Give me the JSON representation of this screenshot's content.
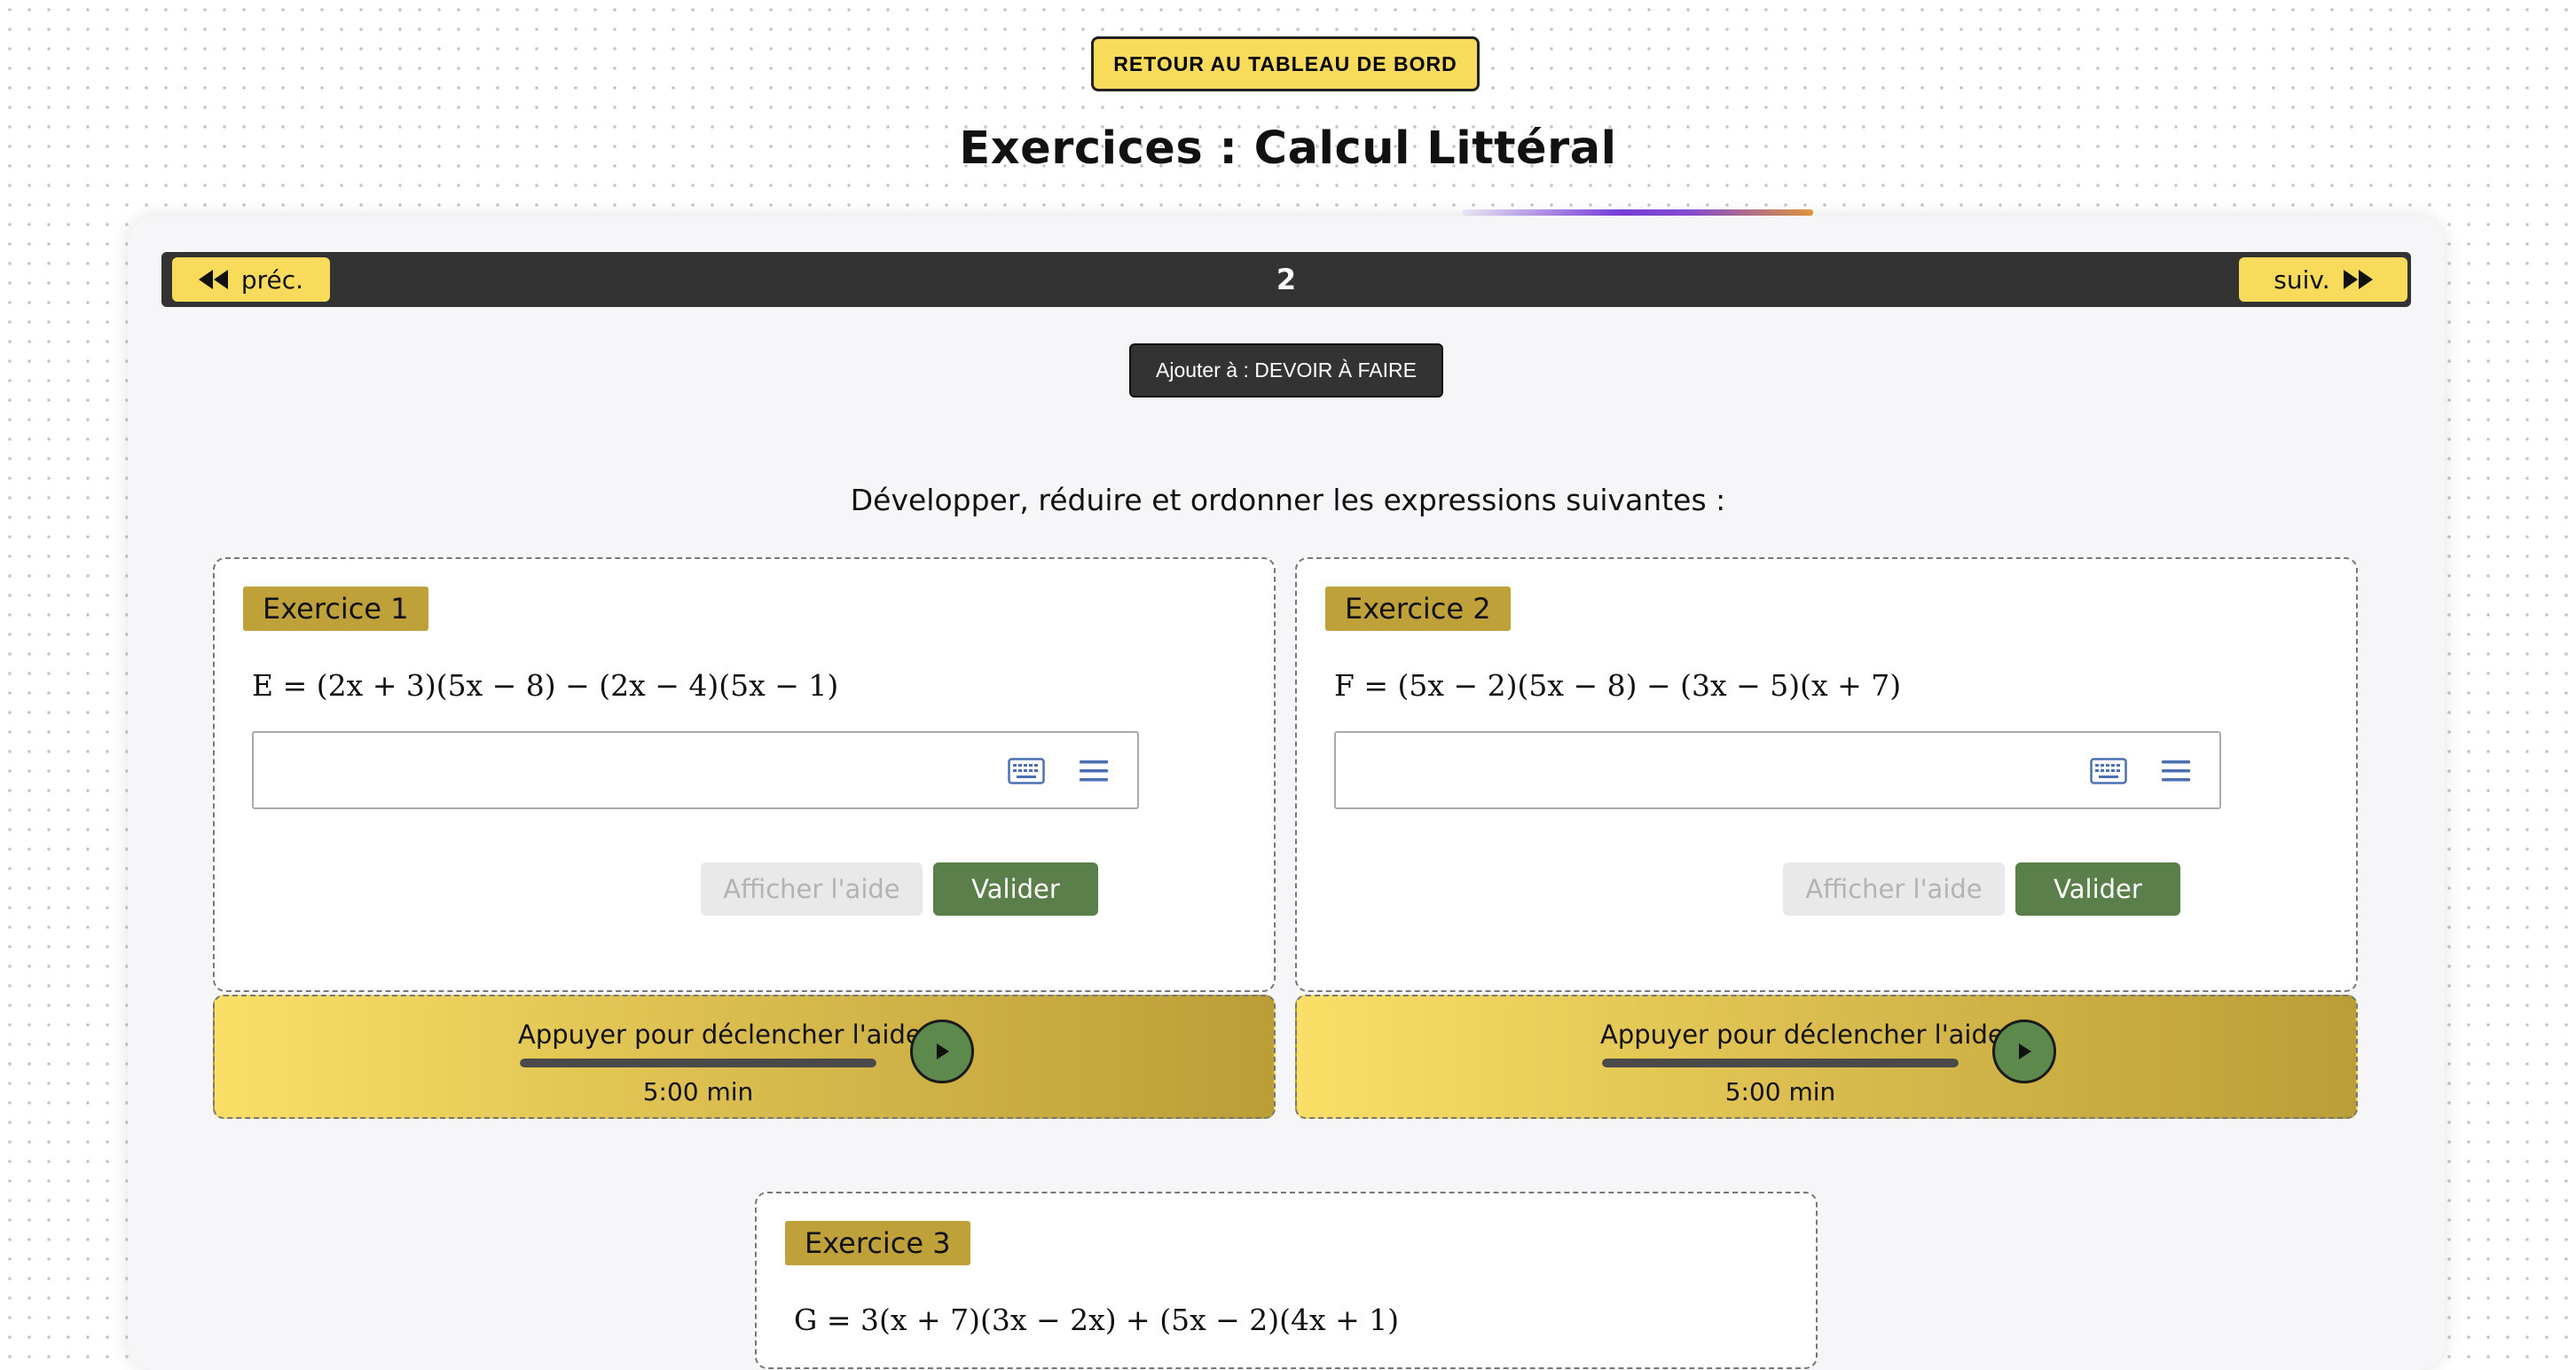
{
  "header": {
    "back_button": "RETOUR AU TABLEAU DE BORD",
    "title": "Exercices : Calcul Littéral"
  },
  "nav": {
    "prev_label": "préc.",
    "next_label": "suiv.",
    "page_number": "2"
  },
  "homework_button": "Ajouter à : DEVOIR À FAIRE",
  "instruction": "Développer, réduire et ordonner les expressions suivantes :",
  "exercises": [
    {
      "label": "Exercice 1",
      "expression": "E = (2x + 3)(5x − 8) − (2x − 4)(5x − 1)",
      "answer_value": "",
      "help_label": "Afficher l'aide",
      "validate_label": "Valider",
      "hint_text": "Appuyer pour déclencher l'aide",
      "hint_time": "5:00 min",
      "hint_progress": 1.0
    },
    {
      "label": "Exercice 2",
      "expression": "F = (5x − 2)(5x − 8) − (3x − 5)(x + 7)",
      "answer_value": "",
      "help_label": "Afficher l'aide",
      "validate_label": "Valider",
      "hint_text": "Appuyer pour déclencher l'aide",
      "hint_time": "5:00 min",
      "hint_progress": 1.0
    },
    {
      "label": "Exercice 3",
      "expression": "G = 3(x + 7)(3x − 2x) + (5x − 2)(4x + 1)"
    }
  ],
  "icons": {
    "prev": "double-chevron-left-icon",
    "next": "double-chevron-right-icon",
    "keyboard": "keyboard-icon",
    "menu": "menu-icon",
    "play": "play-icon"
  },
  "colors": {
    "accent_yellow": "#f8db5a",
    "label_gold": "#bfa13a",
    "validate_green": "#5a7f4a",
    "nav_dark": "#333333",
    "play_green": "#5d8a4c"
  }
}
